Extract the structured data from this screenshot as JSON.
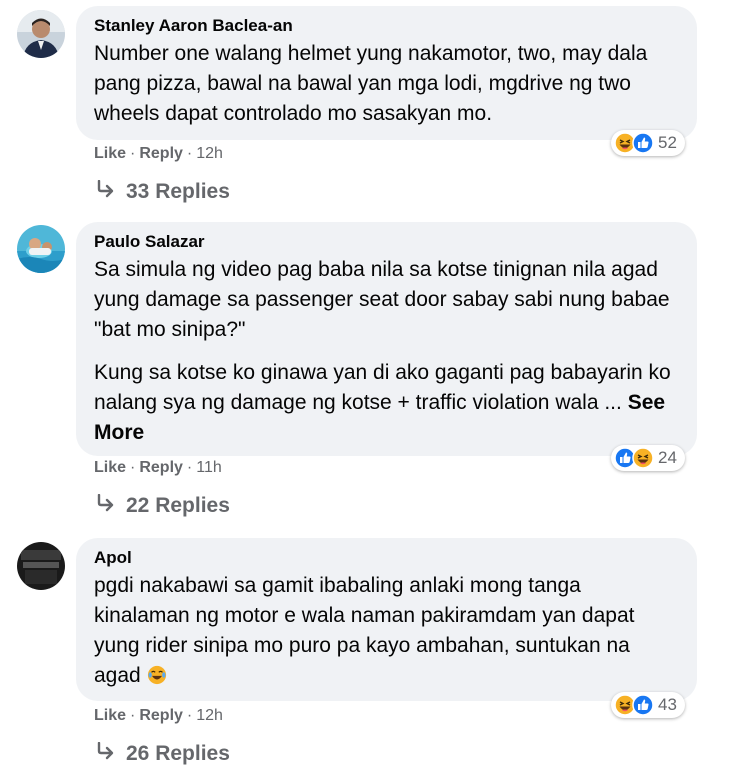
{
  "colors": {
    "bubble": "#f0f2f5",
    "secondary_text": "#65676b",
    "like_blue": "#1877f2",
    "haha_yellow": "#f7b125"
  },
  "comments": [
    {
      "author": "Stanley Aaron Baclea-an",
      "paragraphs": [
        "Number one walang helmet yung nakamotor, two, may dala pang pizza, bawal na bawal yan mga lodi, mgdrive ng two wheels dapat controlado mo sasakyan mo."
      ],
      "reactions": [
        "haha-icon",
        "like-icon"
      ],
      "reaction_count": "52",
      "like_label": "Like",
      "reply_label": "Reply",
      "time": "12h",
      "replies_label": "33 Replies"
    },
    {
      "author": "Paulo Salazar",
      "paragraphs": [
        "Sa simula ng video pag baba nila sa kotse tinignan nila agad yung damage sa passenger seat door sabay sabi nung babae \"bat mo sinipa?\"",
        "Kung sa kotse ko ginawa yan di ako gaganti pag babayarin ko nalang sya ng damage ng kotse + traffic violation wala ..."
      ],
      "see_more": "See More",
      "reactions": [
        "like-icon",
        "haha-icon"
      ],
      "reaction_count": "24",
      "like_label": "Like",
      "reply_label": "Reply",
      "time": "11h",
      "replies_label": "22 Replies"
    },
    {
      "author": "Apol",
      "paragraphs": [
        "pgdi nakabawi sa gamit ibabaling anlaki mong tanga kinalaman ng motor e wala naman pakiramdam yan dapat yung rider sinipa mo puro pa kayo ambahan, suntukan na agad"
      ],
      "inline_emoji": "laughing-crying-emoji",
      "reactions": [
        "haha-icon",
        "like-icon"
      ],
      "reaction_count": "43",
      "like_label": "Like",
      "reply_label": "Reply",
      "time": "12h",
      "replies_label": "26 Replies"
    }
  ]
}
